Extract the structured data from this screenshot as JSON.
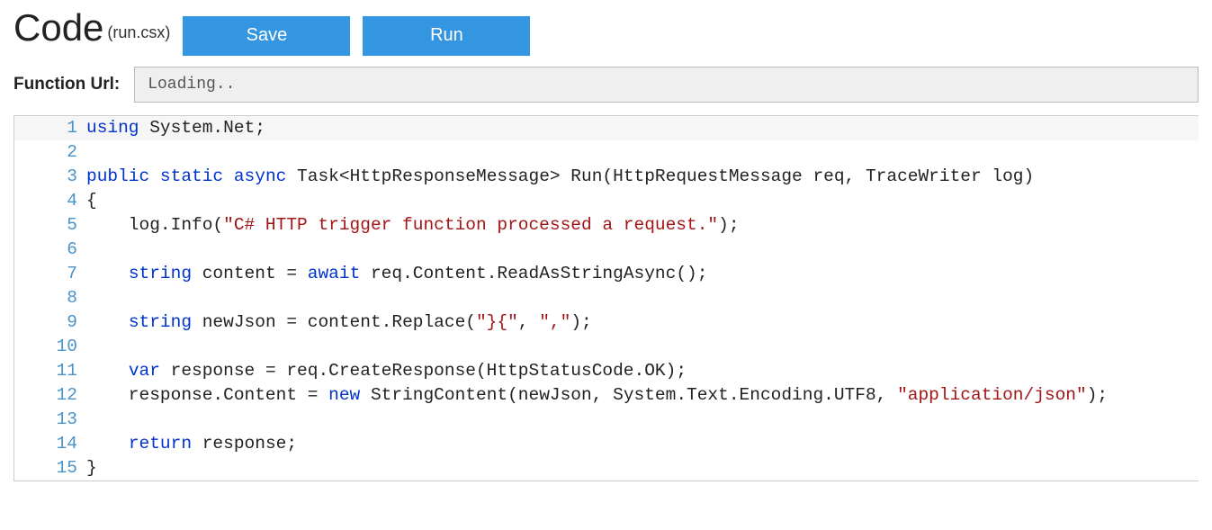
{
  "header": {
    "title": "Code",
    "subtitle": "(run.csx)",
    "save_label": "Save",
    "run_label": "Run"
  },
  "url": {
    "label": "Function Url:",
    "value": "Loading.."
  },
  "editor": {
    "lines": [
      {
        "n": "1",
        "hl": true,
        "tokens": [
          {
            "c": "kw",
            "t": "using"
          },
          {
            "c": "txt",
            "t": " System.Net;"
          }
        ]
      },
      {
        "n": "2",
        "tokens": []
      },
      {
        "n": "3",
        "tokens": [
          {
            "c": "kw",
            "t": "public"
          },
          {
            "c": "txt",
            "t": " "
          },
          {
            "c": "kw",
            "t": "static"
          },
          {
            "c": "txt",
            "t": " "
          },
          {
            "c": "kw",
            "t": "async"
          },
          {
            "c": "txt",
            "t": " Task<HttpResponseMessage> Run(HttpRequestMessage req, TraceWriter log)"
          }
        ]
      },
      {
        "n": "4",
        "tokens": [
          {
            "c": "txt",
            "t": "{"
          }
        ]
      },
      {
        "n": "5",
        "tokens": [
          {
            "c": "txt",
            "t": "    log.Info("
          },
          {
            "c": "str",
            "t": "\"C# HTTP trigger function processed a request.\""
          },
          {
            "c": "txt",
            "t": ");"
          }
        ]
      },
      {
        "n": "6",
        "tokens": []
      },
      {
        "n": "7",
        "tokens": [
          {
            "c": "txt",
            "t": "    "
          },
          {
            "c": "kw",
            "t": "string"
          },
          {
            "c": "txt",
            "t": " content = "
          },
          {
            "c": "kw",
            "t": "await"
          },
          {
            "c": "txt",
            "t": " req.Content.ReadAsStringAsync();"
          }
        ]
      },
      {
        "n": "8",
        "tokens": []
      },
      {
        "n": "9",
        "tokens": [
          {
            "c": "txt",
            "t": "    "
          },
          {
            "c": "kw",
            "t": "string"
          },
          {
            "c": "txt",
            "t": " newJson = content.Replace("
          },
          {
            "c": "str",
            "t": "\"}{\""
          },
          {
            "c": "txt",
            "t": ", "
          },
          {
            "c": "str",
            "t": "\",\""
          },
          {
            "c": "txt",
            "t": ");"
          }
        ]
      },
      {
        "n": "10",
        "tokens": []
      },
      {
        "n": "11",
        "tokens": [
          {
            "c": "txt",
            "t": "    "
          },
          {
            "c": "kw",
            "t": "var"
          },
          {
            "c": "txt",
            "t": " response = req.CreateResponse(HttpStatusCode.OK);"
          }
        ]
      },
      {
        "n": "12",
        "tokens": [
          {
            "c": "txt",
            "t": "    response.Content = "
          },
          {
            "c": "kw",
            "t": "new"
          },
          {
            "c": "txt",
            "t": " StringContent(newJson, System.Text.Encoding.UTF8, "
          },
          {
            "c": "str",
            "t": "\"application/json\""
          },
          {
            "c": "txt",
            "t": ");"
          }
        ]
      },
      {
        "n": "13",
        "tokens": []
      },
      {
        "n": "14",
        "tokens": [
          {
            "c": "txt",
            "t": "    "
          },
          {
            "c": "kw",
            "t": "return"
          },
          {
            "c": "txt",
            "t": " response;"
          }
        ]
      },
      {
        "n": "15",
        "tokens": [
          {
            "c": "txt",
            "t": "}"
          }
        ]
      }
    ]
  }
}
